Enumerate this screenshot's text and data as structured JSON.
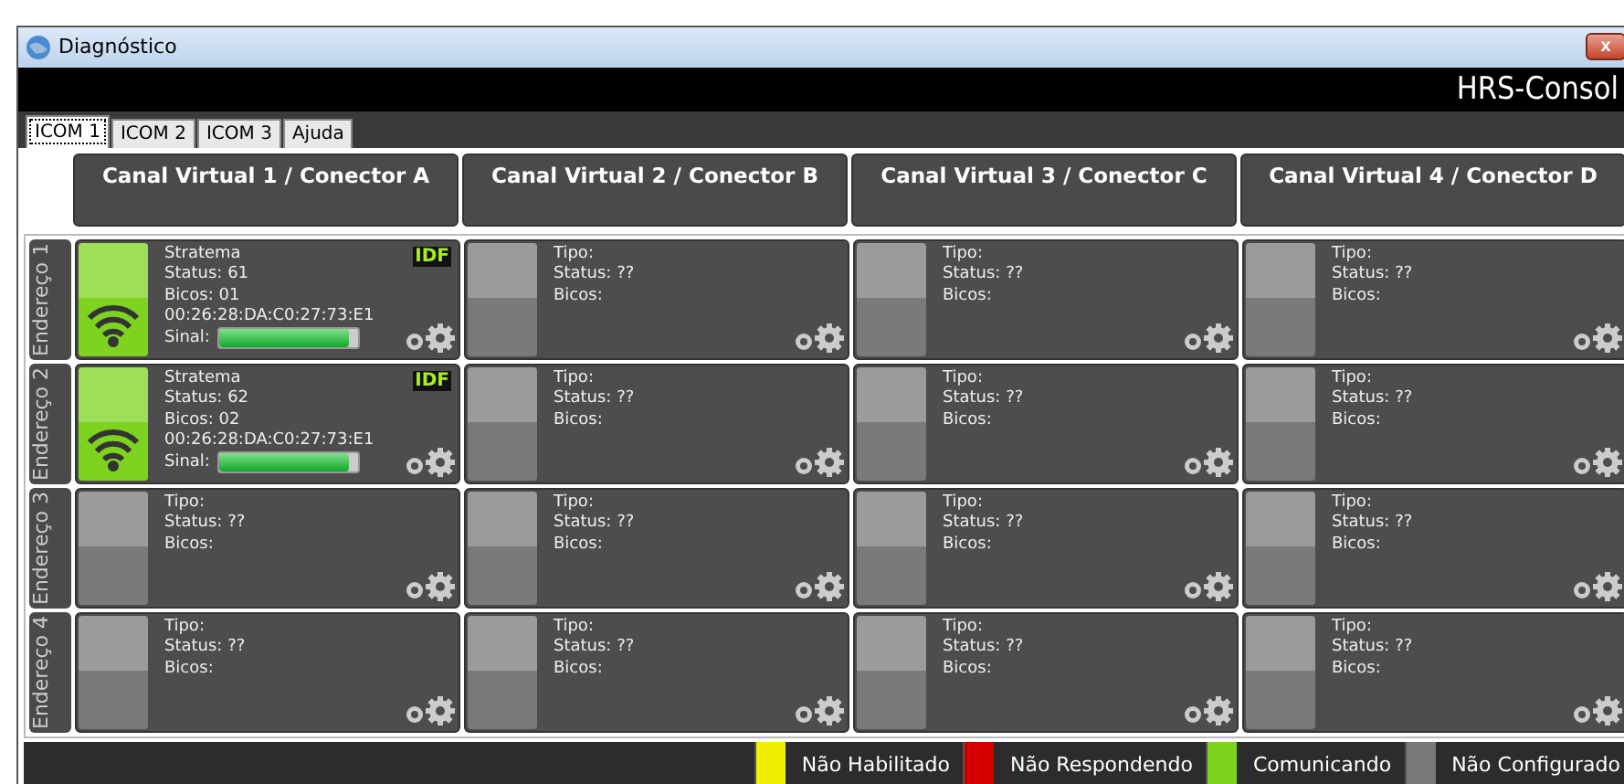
{
  "window": {
    "title": "Diagnóstico",
    "brand": "HRS-Consol",
    "close": "x"
  },
  "tabs": [
    {
      "label": "ICOM 1",
      "selected": true
    },
    {
      "label": "ICOM 2",
      "selected": false
    },
    {
      "label": "ICOM 3",
      "selected": false
    },
    {
      "label": "Ajuda",
      "selected": false
    }
  ],
  "columns": [
    "Canal Virtual 1 / Conector A",
    "Canal Virtual 2 / Conector B",
    "Canal Virtual 3 / Conector C",
    "Canal Virtual 4 / Conector D"
  ],
  "rows": [
    {
      "label": "Endereço 1",
      "cells": [
        {
          "kind": "device",
          "color": "#7ed321",
          "name": "Stratema",
          "status": "Status: 61",
          "bicos": "Bicos: 01",
          "mac": "00:26:28:DA:C0:27:73:E1",
          "signal_label": "Sinal:",
          "level": 0.94,
          "badge": "IDF"
        },
        {
          "kind": "empty",
          "tipo": "Tipo:",
          "status": "Status: ??",
          "bicos": "Bicos:"
        },
        {
          "kind": "empty",
          "tipo": "Tipo:",
          "status": "Status: ??",
          "bicos": "Bicos:"
        },
        {
          "kind": "empty",
          "tipo": "Tipo:",
          "status": "Status: ??",
          "bicos": "Bicos:"
        }
      ]
    },
    {
      "label": "Endereço 2",
      "cells": [
        {
          "kind": "device",
          "color": "#7ed321",
          "name": "Stratema",
          "status": "Status: 62",
          "bicos": "Bicos: 02",
          "mac": "00:26:28:DA:C0:27:73:E1",
          "signal_label": "Sinal:",
          "level": 0.94,
          "badge": "IDF"
        },
        {
          "kind": "empty",
          "tipo": "Tipo:",
          "status": "Status: ??",
          "bicos": "Bicos:"
        },
        {
          "kind": "empty",
          "tipo": "Tipo:",
          "status": "Status: ??",
          "bicos": "Bicos:"
        },
        {
          "kind": "empty",
          "tipo": "Tipo:",
          "status": "Status: ??",
          "bicos": "Bicos:"
        }
      ]
    },
    {
      "label": "Endereço 3",
      "cells": [
        {
          "kind": "empty",
          "tipo": "Tipo:",
          "status": "Status: ??",
          "bicos": "Bicos:"
        },
        {
          "kind": "empty",
          "tipo": "Tipo:",
          "status": "Status: ??",
          "bicos": "Bicos:"
        },
        {
          "kind": "empty",
          "tipo": "Tipo:",
          "status": "Status: ??",
          "bicos": "Bicos:"
        },
        {
          "kind": "empty",
          "tipo": "Tipo:",
          "status": "Status: ??",
          "bicos": "Bicos:"
        }
      ]
    },
    {
      "label": "Endereço 4",
      "cells": [
        {
          "kind": "empty",
          "tipo": "Tipo:",
          "status": "Status: ??",
          "bicos": "Bicos:"
        },
        {
          "kind": "empty",
          "tipo": "Tipo:",
          "status": "Status: ??",
          "bicos": "Bicos:"
        },
        {
          "kind": "empty",
          "tipo": "Tipo:",
          "status": "Status: ??",
          "bicos": "Bicos:"
        },
        {
          "kind": "empty",
          "tipo": "Tipo:",
          "status": "Status: ??",
          "bicos": "Bicos:"
        }
      ]
    }
  ],
  "legend": [
    {
      "label": "Não Habilitado",
      "color": "#f2ee00"
    },
    {
      "label": "Não Respondendo",
      "color": "#d40000"
    },
    {
      "label": "Comunicando",
      "color": "#7ed321"
    },
    {
      "label": "Não Configurado",
      "color": "#7a7a7a"
    }
  ]
}
